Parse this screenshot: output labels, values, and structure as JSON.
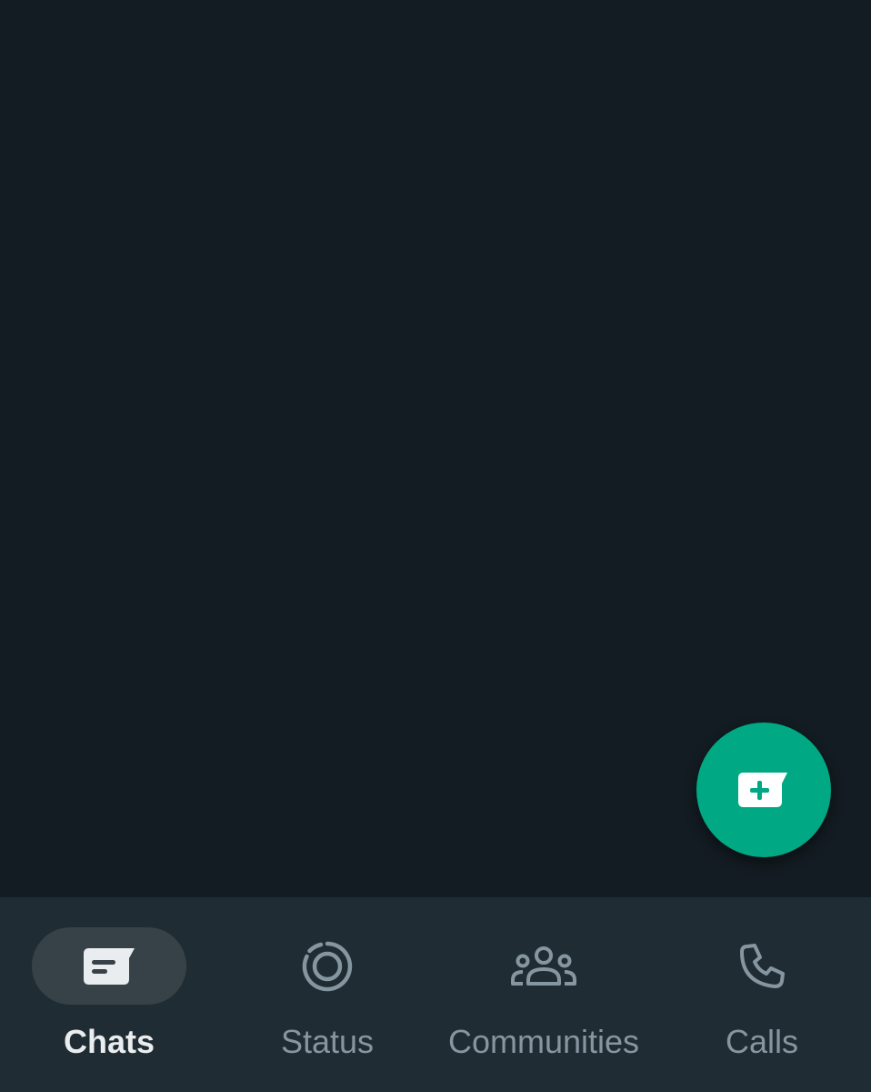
{
  "colors": {
    "background": "#131c22",
    "nav_background": "#202c33",
    "accent": "#00a884",
    "active_pill": "#374248",
    "active_text": "#e9edef",
    "inactive_text": "#8696a0"
  },
  "fab": {
    "icon": "new-chat-icon"
  },
  "nav": {
    "items": [
      {
        "label": "Chats",
        "icon": "chats-icon",
        "active": true
      },
      {
        "label": "Status",
        "icon": "status-icon",
        "active": false
      },
      {
        "label": "Communities",
        "icon": "communities-icon",
        "active": false
      },
      {
        "label": "Calls",
        "icon": "calls-icon",
        "active": false
      }
    ]
  }
}
